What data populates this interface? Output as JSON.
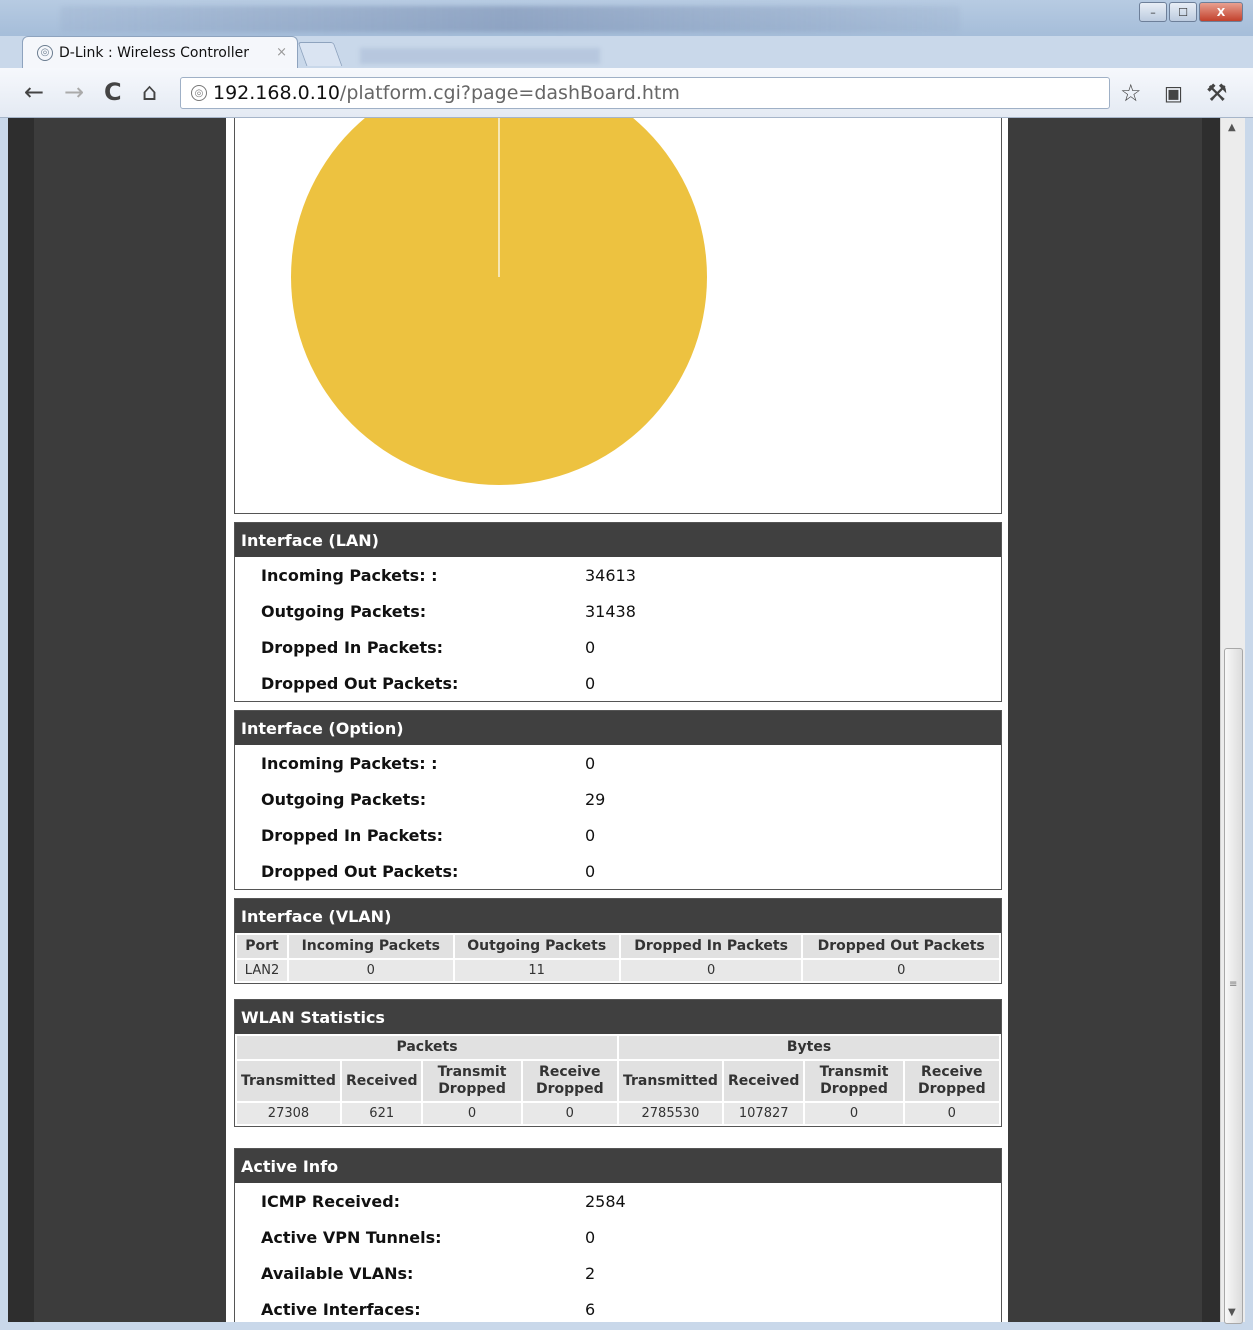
{
  "browser": {
    "tab_title": "D-Link : Wireless Controller",
    "tab_close": "×",
    "url_host": "192.168.0.10",
    "url_path": "/platform.cgi?page=dashBoard.htm"
  },
  "window_buttons": {
    "minimize": "–",
    "maximize": "☐",
    "close": "X"
  },
  "pie_chart": {
    "color": "#edc240",
    "divider_color": "#f6e7b4"
  },
  "lan": {
    "title": "Interface (LAN)",
    "rows": [
      {
        "label": "Incoming Packets: :",
        "value": "34613"
      },
      {
        "label": "Outgoing Packets:",
        "value": "31438"
      },
      {
        "label": "Dropped In Packets:",
        "value": "0"
      },
      {
        "label": "Dropped Out Packets:",
        "value": "0"
      }
    ]
  },
  "option": {
    "title": "Interface (Option)",
    "rows": [
      {
        "label": "Incoming Packets: :",
        "value": "0"
      },
      {
        "label": "Outgoing Packets:",
        "value": "29"
      },
      {
        "label": "Dropped In Packets:",
        "value": "0"
      },
      {
        "label": "Dropped Out Packets:",
        "value": "0"
      }
    ]
  },
  "vlan": {
    "title": "Interface (VLAN)",
    "headers": [
      "Port",
      "Incoming Packets",
      "Outgoing Packets",
      "Dropped In Packets",
      "Dropped Out Packets"
    ],
    "row": [
      "LAN2",
      "0",
      "11",
      "0",
      "0"
    ]
  },
  "wlan": {
    "title": "WLAN Statistics",
    "group_packets": "Packets",
    "group_bytes": "Bytes",
    "headers": [
      "Transmitted",
      "Received",
      "Transmit Dropped",
      "Receive Dropped",
      "Transmitted",
      "Received",
      "Transmit Dropped",
      "Receive Dropped"
    ],
    "row": [
      "27308",
      "621",
      "0",
      "0",
      "2785530",
      "107827",
      "0",
      "0"
    ]
  },
  "active": {
    "title": "Active Info",
    "rows": [
      {
        "label": "ICMP Received:",
        "value": "2584"
      },
      {
        "label": "Active VPN Tunnels:",
        "value": "0"
      },
      {
        "label": "Available VLANs:",
        "value": "2"
      },
      {
        "label": "Active Interfaces:",
        "value": "6"
      }
    ]
  }
}
